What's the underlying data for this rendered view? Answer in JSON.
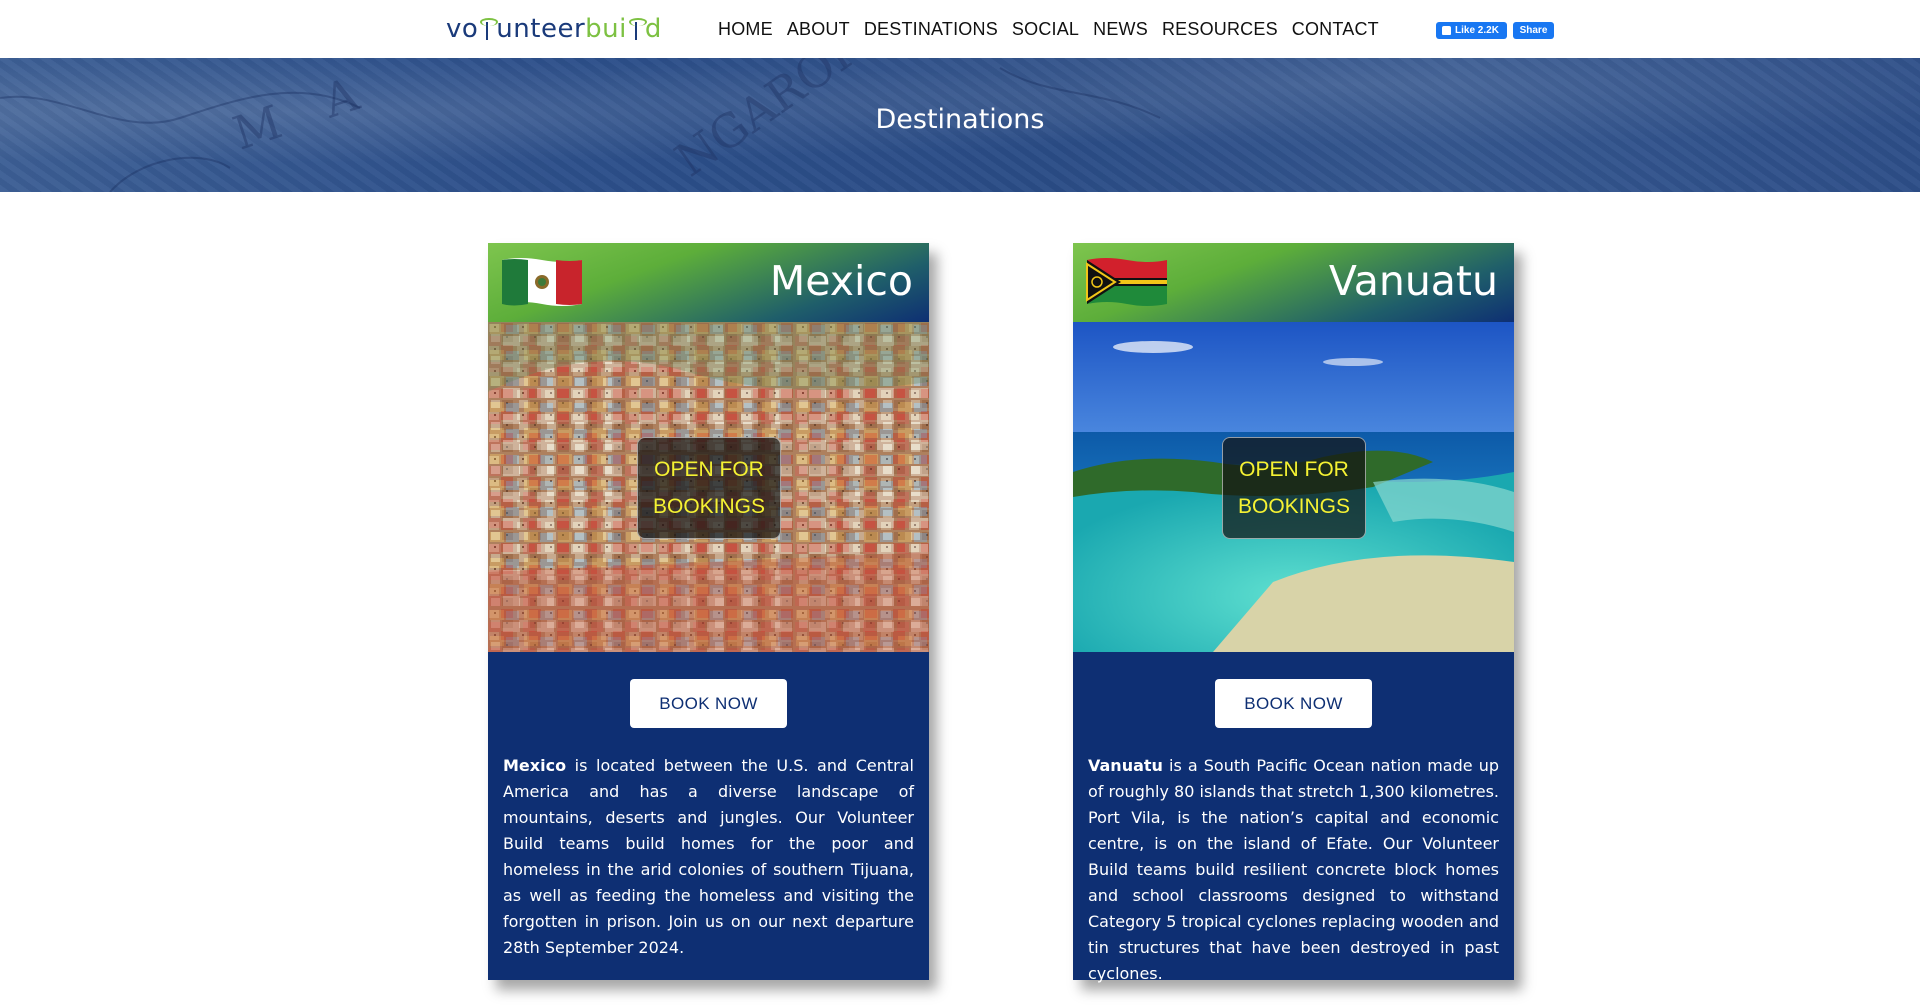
{
  "header": {
    "logo": {
      "part1": "vo",
      "part2": "unteer",
      "part3": "bui",
      "part4": "d"
    },
    "nav": [
      "HOME",
      "ABOUT",
      "DESTINATIONS",
      "SOCIAL",
      "NEWS",
      "RESOURCES",
      "CONTACT"
    ],
    "facebook": {
      "like_label": "Like 2.2K",
      "share_label": "Share"
    }
  },
  "banner": {
    "title": "Destinations"
  },
  "cards": [
    {
      "country": "Mexico",
      "flag_icon": "mexico-flag-icon",
      "badge_line1": "OPEN FOR",
      "badge_line2": "BOOKINGS",
      "button_label": "BOOK NOW",
      "desc_bold": "Mexico",
      "desc_text": " is located between the U.S. and Central America and has a diverse landscape of mountains, deserts and jungles. Our Volunteer Build teams build homes for the poor and homeless in the arid colonies of southern Tijuana, as well as feeding the homeless and visiting the forgotten in prison. Join us on our next departure 28th September 2024."
    },
    {
      "country": "Vanuatu",
      "flag_icon": "vanuatu-flag-icon",
      "badge_line1": "OPEN FOR",
      "badge_line2": "BOOKINGS",
      "button_label": "BOOK NOW",
      "desc_bold": "Vanuatu",
      "desc_text": " is a South Pacific Ocean nation made up of roughly 80 islands that stretch 1,300 kilometres. Port Vila, is the nation’s capital and economic centre, is on the island of Efate.  Our Volunteer Build teams build resilient concrete block homes and school classrooms designed to withstand Category 5 tropical cyclones replacing wooden and tin structures that have been destroyed in past cyclones."
    }
  ],
  "colors": {
    "brand_navy": "#0e2f73",
    "brand_green": "#7dc142",
    "badge_text": "#f5f233",
    "facebook_blue": "#1877f2"
  }
}
